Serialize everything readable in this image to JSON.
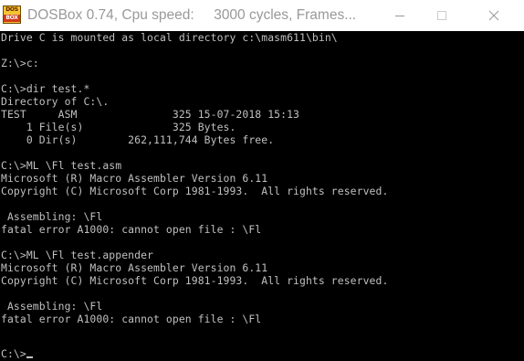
{
  "window": {
    "title": "DOSBox 0.74, Cpu speed:     3000 cycles, Frames...",
    "icon": {
      "name": "dosbox-icon",
      "top_text": "DOS",
      "bottom_text": "BOX"
    },
    "controls": {
      "minimize": "minimize-icon",
      "maximize": "maximize-icon",
      "close": "close-icon"
    }
  },
  "console": {
    "lines": [
      "Drive C is mounted as local directory c:\\masm611\\bin\\",
      "",
      "Z:\\>c:",
      "",
      "C:\\>dir test.*",
      "Directory of C:\\.",
      "TEST     ASM               325 15-07-2018 15:13",
      "    1 File(s)              325 Bytes.",
      "    0 Dir(s)        262,111,744 Bytes free.",
      "",
      "C:\\>ML \\Fl test.asm",
      "Microsoft (R) Macro Assembler Version 6.11",
      "Copyright (C) Microsoft Corp 1981-1993.  All rights reserved.",
      "",
      " Assembling: \\Fl",
      "fatal error A1000: cannot open file : \\Fl",
      "",
      "C:\\>ML \\Fl test.appender",
      "Microsoft (R) Macro Assembler Version 6.11",
      "Copyright (C) Microsoft Corp 1981-1993.  All rights reserved.",
      "",
      " Assembling: \\Fl",
      "fatal error A1000: cannot open file : \\Fl",
      "",
      "C:\\>"
    ]
  },
  "colors": {
    "console_bg": "#000000",
    "console_text": "#c0c0c0",
    "titlebar_bg": "#ffffff",
    "titlebar_text": "#999999"
  }
}
